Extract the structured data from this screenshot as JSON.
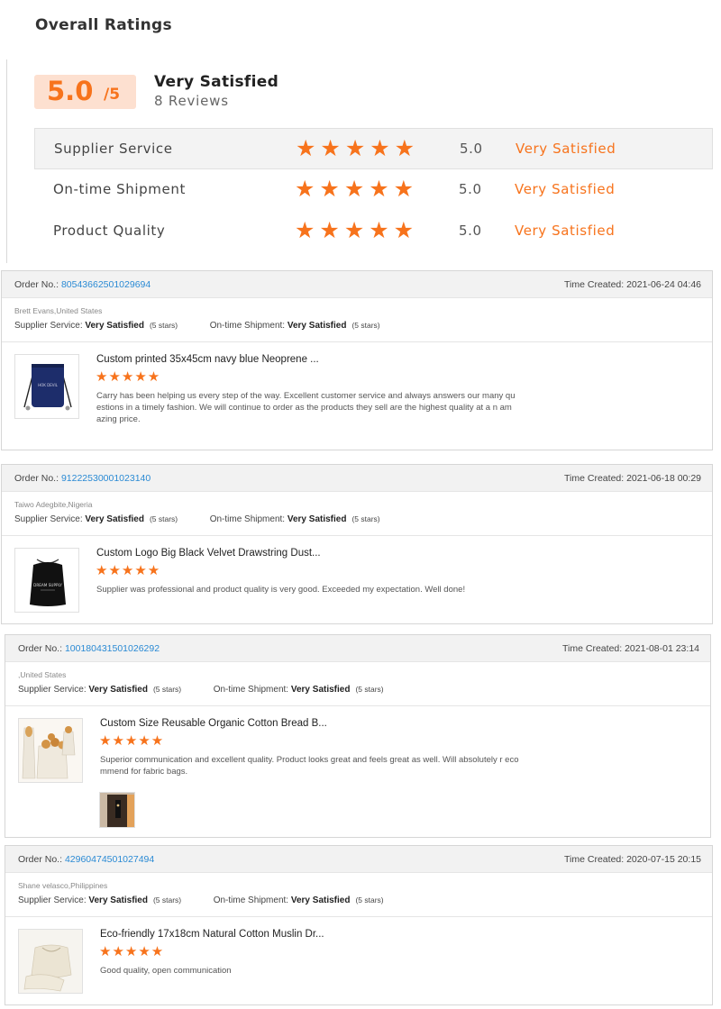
{
  "overall": {
    "title": "Overall Ratings",
    "score": "5.0",
    "score_max": "/5",
    "verdict": "Very Satisfied",
    "reviews": "8 Reviews",
    "star_glyph": "★★★★★",
    "categories": [
      {
        "name": "Supplier Service",
        "rating": 5,
        "score": "5.0",
        "verdict": "Very Satisfied"
      },
      {
        "name": "On-time Shipment",
        "rating": 5,
        "score": "5.0",
        "verdict": "Very Satisfied"
      },
      {
        "name": "Product Quality",
        "rating": 5,
        "score": "5.0",
        "verdict": "Very Satisfied"
      }
    ],
    "colors": {
      "accent": "#f7731c",
      "score_bg": "#fde0d0"
    }
  },
  "labels": {
    "order_no": "Order No.:",
    "time_created": "Time Created:",
    "supplier_service": "Supplier Service:",
    "ontime_shipment": "On-time Shipment:",
    "stars_text": "(5 stars)"
  },
  "reviews": [
    {
      "order_no": "80543662501029694",
      "time": "2021-06-24 04:46",
      "buyer": "Brett Evans,United States",
      "supplier_service": "Very Satisfied",
      "ontime_shipment": "Very Satisfied",
      "product_title": "Custom printed 35x45cm navy blue Neoprene ...",
      "rating": 5,
      "stars": "★★★★★",
      "text": "Carry has been helping us every step of the way. Excellent customer service and always answers our many questions in a timely fashion. We will continue to order as the products they sell are the highest quality at a n amazing price.",
      "thumbnail_icon": "navy-drawstring-bag-icon"
    },
    {
      "order_no": "91222530001023140",
      "time": "2021-06-18 00:29",
      "buyer": "Taiwo Adegbite,Nigeria",
      "supplier_service": "Very Satisfied",
      "ontime_shipment": "Very Satisfied",
      "product_title": "Custom Logo Big Black Velvet Drawstring Dust...",
      "rating": 5,
      "stars": "★★★★★",
      "text": "Supplier was professional and product quality is very good. Exceeded my expectation. Well done!",
      "thumbnail_icon": "black-velvet-bag-icon"
    },
    {
      "order_no": "100180431501026292",
      "time": "2021-08-01 23:14",
      "buyer": ",United States",
      "supplier_service": "Very Satisfied",
      "ontime_shipment": "Very Satisfied",
      "product_title": "Custom Size Reusable Organic Cotton Bread B...",
      "rating": 5,
      "stars": "★★★★★",
      "text": "Superior communication and excellent quality. Product looks great and feels great as well.  Will absolutely r ecommend for fabric bags.",
      "thumbnail_icon": "cotton-bread-bag-icon",
      "extra_image_icon": "buyer-photo-icon"
    },
    {
      "order_no": "42960474501027494",
      "time": "2020-07-15 20:15",
      "buyer": "Shane velasco,Philippines",
      "supplier_service": "Very Satisfied",
      "ontime_shipment": "Very Satisfied",
      "product_title": "Eco-friendly 17x18cm Natural Cotton Muslin Dr...",
      "rating": 5,
      "stars": "★★★★★",
      "text": "Good quality, open communication",
      "thumbnail_icon": "muslin-drawstring-bag-icon"
    }
  ]
}
